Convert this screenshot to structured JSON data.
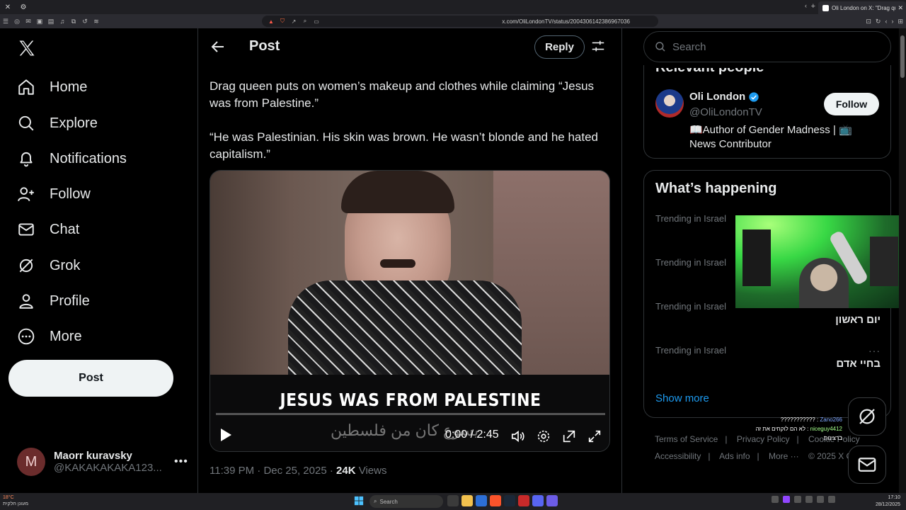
{
  "browser": {
    "tab_title": "Oli London on X: \"Drag queen p",
    "url": "x.com/OliLondonTV/status/2004306142386967036"
  },
  "nav": {
    "items": [
      {
        "label": "Home",
        "icon": "home-icon"
      },
      {
        "label": "Explore",
        "icon": "search-icon"
      },
      {
        "label": "Notifications",
        "icon": "bell-icon"
      },
      {
        "label": "Follow",
        "icon": "person-add-icon"
      },
      {
        "label": "Chat",
        "icon": "mail-icon"
      },
      {
        "label": "Grok",
        "icon": "grok-icon"
      },
      {
        "label": "Profile",
        "icon": "person-icon"
      },
      {
        "label": "More",
        "icon": "more-circle-icon"
      }
    ],
    "post_button": "Post",
    "account": {
      "initial": "M",
      "name": "Maorr kuravsky",
      "handle": "@KAKAKAKAKA123..."
    }
  },
  "header": {
    "title": "Post",
    "reply_label": "Reply"
  },
  "tweet": {
    "text1": "Drag queen puts on women’s makeup and clothes while claiming “Jesus was from Palestine.”",
    "text2": "“He was Palestinian. His skin was brown. He wasn’t blonde and he hated capitalism.”",
    "video": {
      "caption": "JESUS WAS FROM PALESTINE",
      "arabic_caption": "يسوع كان من فلسطين",
      "time": "0:00 / 2:45",
      "progress": 0
    },
    "time": "11:39 PM",
    "date": "Dec 25, 2025",
    "views_count": "24K",
    "views_label": "Views"
  },
  "search": {
    "placeholder": "Search"
  },
  "relevant": {
    "title": "Relevant people",
    "name": "Oli London",
    "handle": "@OliLondonTV",
    "bio": "📖Author of Gender Madness | 📺 News Contributor",
    "follow_label": "Follow"
  },
  "happening": {
    "title": "What’s happening",
    "trends": [
      {
        "category": "Trending in Israel",
        "name": ""
      },
      {
        "category": "Trending in Israel",
        "name": ""
      },
      {
        "category": "Trending in Israel",
        "name": "יום ראשון"
      },
      {
        "category": "Trending in Israel",
        "name": "בחיי אדם"
      }
    ],
    "show_more": "Show more"
  },
  "footer": {
    "links": [
      "Terms of Service",
      "Privacy Policy",
      "Cookie Policy",
      "Accessibility",
      "Ads info",
      "More ···",
      "© 2025 X Corp."
    ]
  },
  "chat_overlay": {
    "line1_user": "Zano266",
    "line1_text": ": ???????????",
    "line2_user": "niceguy4412",
    "line2_text": ": לא הם לוקחים את זה ברצינות"
  },
  "taskbar": {
    "weather": "18°C",
    "weather_sub": "מעונן חלקית",
    "search_placeholder": "Search",
    "time": "17:10",
    "date": "28/12/2025"
  }
}
